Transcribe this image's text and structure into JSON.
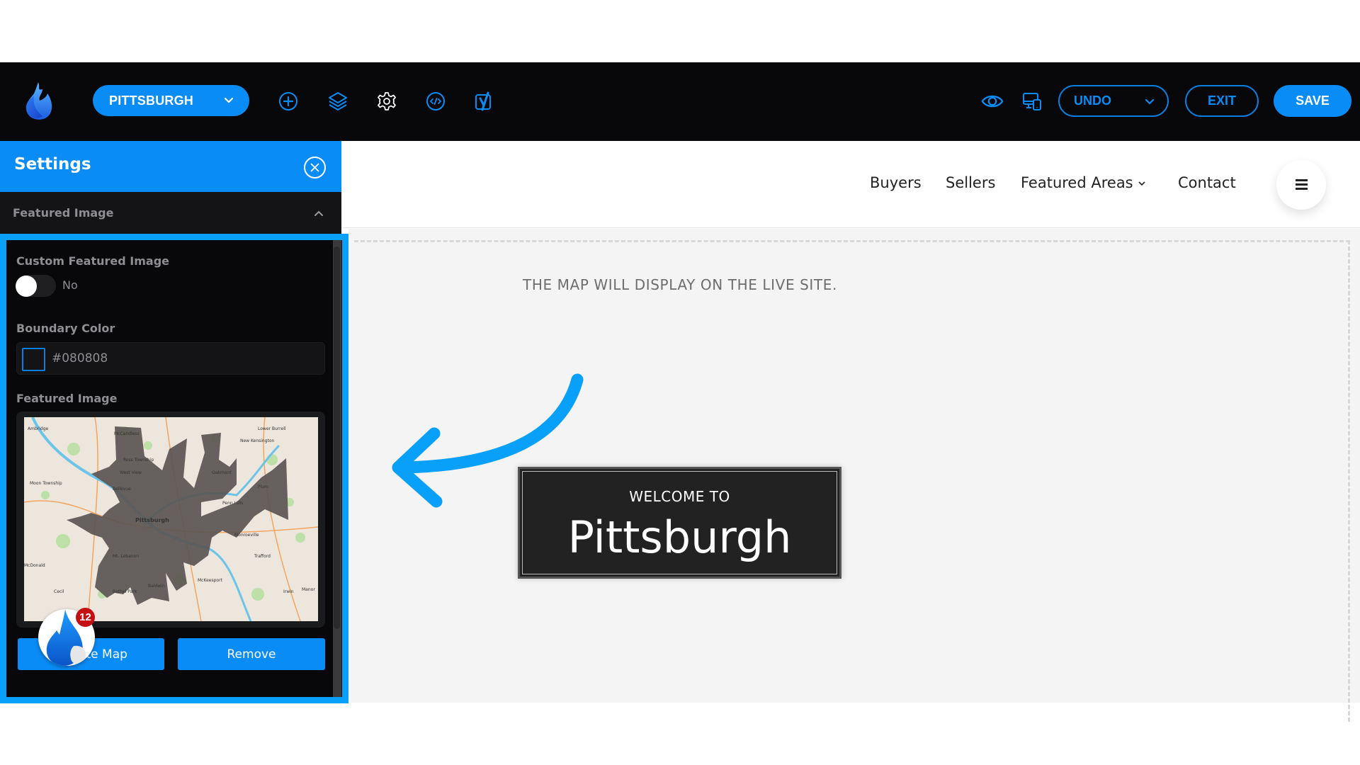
{
  "toolbar": {
    "site_selector": "PITTSBURGH",
    "icons": [
      "add-icon",
      "layers-icon",
      "settings-gear-icon",
      "code-icon",
      "yoast-seo-icon",
      "preview-eye-icon",
      "responsive-devices-icon"
    ],
    "undo_label": "UNDO",
    "exit_label": "EXIT",
    "save_label": "SAVE"
  },
  "settings_panel": {
    "title": "Settings",
    "section_title": "Featured Image",
    "custom_featured_image": {
      "label": "Custom Featured Image",
      "toggle_state": "No"
    },
    "boundary_color": {
      "label": "Boundary Color",
      "value": "#080808"
    },
    "featured_image": {
      "label": "Featured Image",
      "map_labels": [
        "Ambridge",
        "McCandless",
        "Lower Burrell",
        "New Kensington",
        "Ross Township",
        "West View",
        "Oakmont",
        "Moon Township",
        "Bellevue",
        "Plum",
        "Penn Hills",
        "Pittsburgh",
        "Monroeville",
        "Mt. Lebanon",
        "Trafford",
        "McDonald",
        "McKeesport",
        "Baldwin",
        "Bethel Park",
        "Cecil",
        "Irwin",
        "Manor"
      ]
    },
    "update_button": "Update Map",
    "remove_button": "Remove",
    "notification_count": "12"
  },
  "site": {
    "nav": [
      {
        "label": "Buyers"
      },
      {
        "label": "Sellers"
      },
      {
        "label": "Featured Areas",
        "has_dropdown": true
      },
      {
        "label": "Contact"
      }
    ],
    "map_note": "THE MAP WILL DISPLAY ON THE LIVE SITE.",
    "welcome_sub": "WELCOME TO",
    "welcome_title": "Pittsburgh"
  },
  "colors": {
    "accent": "#0a8cf7",
    "highlight": "#08a0f8",
    "toolbar_bg": "#08080a",
    "badge": "#c40f14"
  }
}
